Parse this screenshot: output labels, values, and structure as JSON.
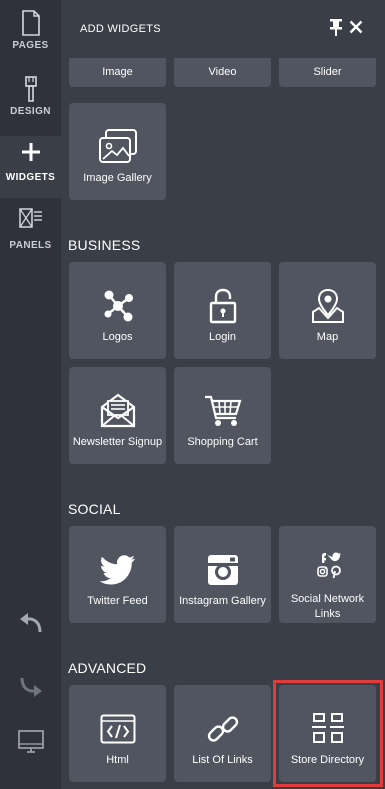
{
  "rail": {
    "pages_label": "PAGES",
    "design_label": "DESIGN",
    "widgets_label": "WIDGETS",
    "panels_label": "PANELS"
  },
  "panel": {
    "title": "ADD WIDGETS"
  },
  "top_tiles": [
    "Image",
    "Video",
    "Slider"
  ],
  "media": {
    "image_gallery": "Image Gallery"
  },
  "business": {
    "title": "BUSINESS",
    "logos": "Logos",
    "login": "Login",
    "map": "Map",
    "newsletter": "Newsletter Signup",
    "cart": "Shopping Cart"
  },
  "social": {
    "title": "SOCIAL",
    "twitter": "Twitter Feed",
    "instagram": "Instagram Gallery",
    "social_links": "Social Network Links"
  },
  "advanced": {
    "title": "ADVANCED",
    "html": "Html",
    "list_links": "List Of Links",
    "store_directory": "Store Directory"
  },
  "colors": {
    "rail_bg": "#2f323a",
    "panel_bg": "#3a3e47",
    "tile_bg": "#50555f",
    "highlight": "#e23b3b"
  }
}
